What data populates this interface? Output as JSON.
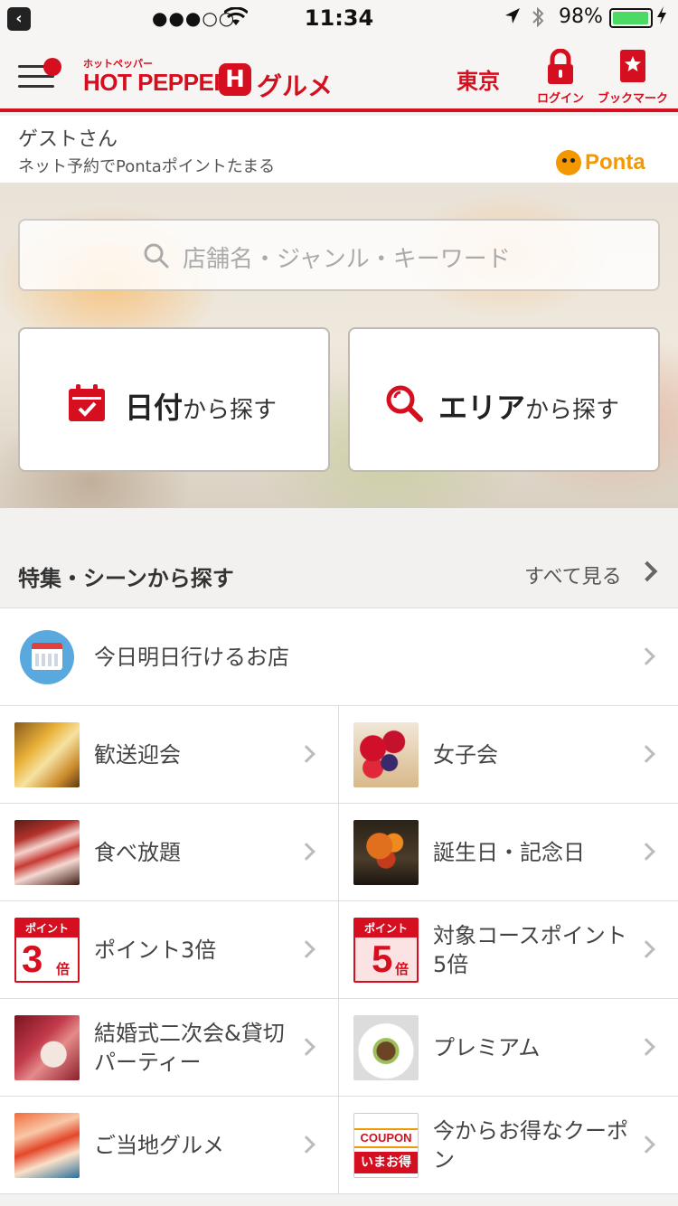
{
  "status_bar": {
    "time": "11:34",
    "battery": "98%",
    "battery_level": 0.98,
    "accent_battery": "#4cd964"
  },
  "header": {
    "logo_kana": "ホットペッパー",
    "logo_main": "HOT PEPPER",
    "logo_h": "H",
    "logo_gurume": "グルメ",
    "area": "東京",
    "login_label": "ログイン",
    "bookmark_label": "ブックマーク",
    "brand_color": "#d50f1f"
  },
  "guest": {
    "name": "ゲストさん",
    "subtitle": "ネット予約でPontaポイントたまる",
    "ponta": "Ponta"
  },
  "search": {
    "placeholder": "店舗名・ジャンル・キーワード"
  },
  "big_buttons": {
    "date_bold": "日付",
    "date_rest": "から探す",
    "area_bold": "エリア",
    "area_rest": "から探す"
  },
  "section": {
    "title": "特集・シーンから探す",
    "see_all": "すべて見る"
  },
  "list": {
    "today": "今日明日行けるお店",
    "items": [
      {
        "label": "歓送迎会",
        "icon": "beer-icon"
      },
      {
        "label": "女子会",
        "icon": "berry-tart-icon"
      },
      {
        "label": "食べ放題",
        "icon": "meat-icon"
      },
      {
        "label": "誕生日・記念日",
        "icon": "flower-icon"
      },
      {
        "label": "ポイント3倍",
        "icon": "point-3x-icon"
      },
      {
        "label": "対象コースポイント5倍",
        "icon": "point-5x-icon"
      },
      {
        "label": "結婚式二次会&貸切パーティー",
        "icon": "wedding-icon"
      },
      {
        "label": "プレミアム",
        "icon": "premium-icon"
      },
      {
        "label": "ご当地グルメ",
        "icon": "local-food-icon"
      },
      {
        "label": "今からお得なクーポン",
        "icon": "coupon-icon"
      }
    ],
    "badges": {
      "point_top": "ポイント",
      "point3_num": "3",
      "point5_num": "5",
      "bai": "倍",
      "coupon_top": "COUPON",
      "coupon_bottom": "いまお得"
    }
  }
}
